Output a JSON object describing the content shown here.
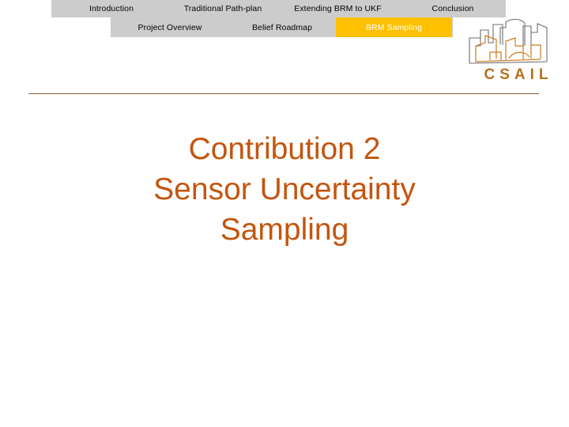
{
  "nav": {
    "primary": [
      {
        "label": "Introduction",
        "active": false
      },
      {
        "label": "Traditional Path-plan",
        "active": false
      },
      {
        "label": "Extending BRM to UKF",
        "active": false
      },
      {
        "label": "Conclusion",
        "active": false
      }
    ],
    "secondary": [
      {
        "label": "Project Overview",
        "active": false
      },
      {
        "label": "Belief Roadmap",
        "active": false
      },
      {
        "label": "BRM Sampling",
        "active": true
      }
    ],
    "bar_color": "#cccccc",
    "active_color": "#ffc000",
    "active_text_color": "#ffffff"
  },
  "logo": {
    "wordmark": "CSAIL",
    "skyline_icon": "city-skyline-icon",
    "wordmark_color": "#b5701f",
    "skyline_back_color": "#6e6e6e",
    "skyline_front_color": "#c87d21"
  },
  "divider": {
    "color": "#8a5a2b"
  },
  "title": {
    "line1": "Contribution 2",
    "line2": "Sensor Uncertainty",
    "line3": "Sampling",
    "color": "#c4550f"
  }
}
